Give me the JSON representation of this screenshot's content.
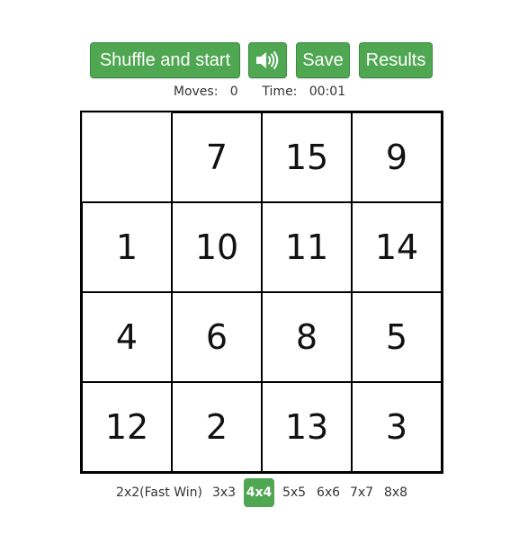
{
  "toolbar": {
    "shuffle_label": "Shuffle and start",
    "sound_icon": "speaker-icon",
    "save_label": "Save",
    "results_label": "Results"
  },
  "stats": {
    "moves_label": "Moves:",
    "moves_value": "0",
    "time_label": "Time:",
    "time_value": "00:01"
  },
  "board": {
    "size": 4,
    "tiles": [
      "",
      "7",
      "15",
      "9",
      "1",
      "10",
      "11",
      "14",
      "4",
      "6",
      "8",
      "5",
      "12",
      "2",
      "13",
      "3"
    ]
  },
  "sizes": [
    {
      "label": "2x2(Fast Win)",
      "active": false
    },
    {
      "label": "3x3",
      "active": false
    },
    {
      "label": "4x4",
      "active": true
    },
    {
      "label": "5x5",
      "active": false
    },
    {
      "label": "6x6",
      "active": false
    },
    {
      "label": "7x7",
      "active": false
    },
    {
      "label": "8x8",
      "active": false
    }
  ],
  "colors": {
    "accent": "#4fa752",
    "accent_border": "#3d8a40",
    "grid_line": "#000000"
  }
}
